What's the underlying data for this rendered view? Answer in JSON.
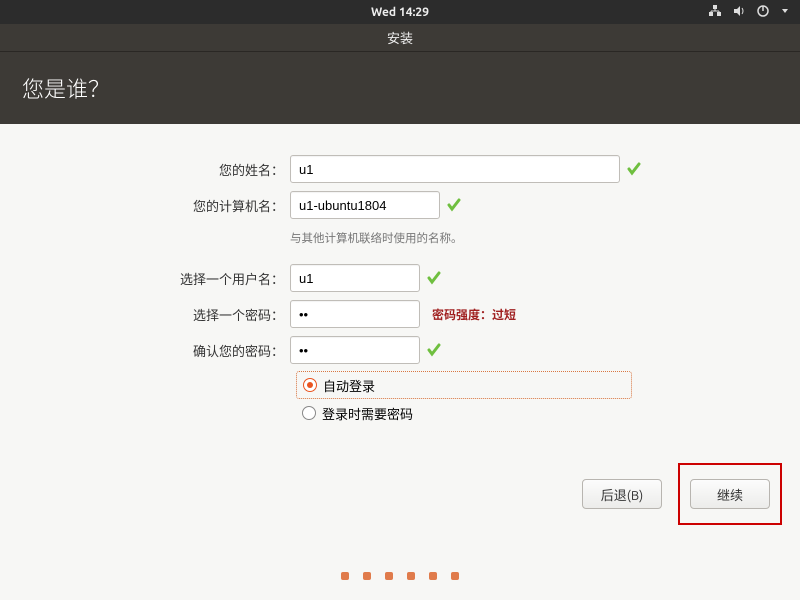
{
  "topbar": {
    "clock": "Wed 14:29",
    "icons": {
      "network": "network-icon",
      "volume": "volume-icon",
      "power": "power-icon",
      "dropdown": "chevron-down-icon"
    }
  },
  "window": {
    "title": "安装"
  },
  "heading": "您是谁？",
  "form": {
    "name_label": "您的姓名：",
    "name_value": "u1",
    "host_label": "您的计算机名：",
    "host_value": "u1-ubuntu1804",
    "host_helper": "与其他计算机联络时使用的名称。",
    "user_label": "选择一个用户名：",
    "user_value": "u1",
    "pass_label": "选择一个密码：",
    "pass_value": "••",
    "pass_strength": "密码强度：过短",
    "confirm_label": "确认您的密码：",
    "confirm_value": "••",
    "radio_auto": "自动登录",
    "radio_manual": "登录时需要密码",
    "radio_selected": "auto"
  },
  "footer": {
    "back": "后退(B)",
    "continue": "继续"
  },
  "progress": {
    "dots": 6
  }
}
